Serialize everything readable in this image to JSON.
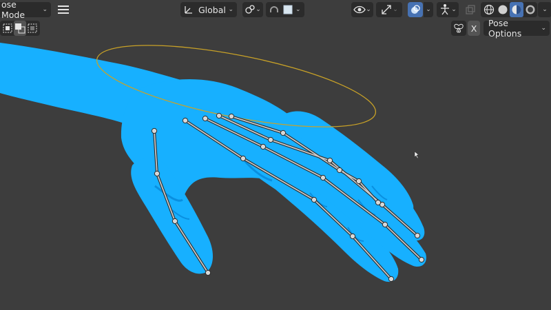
{
  "header": {
    "mode_label": "ose Mode",
    "transform_orientation": "Global"
  },
  "subheader": {
    "pose_options_label": "Pose Options",
    "mirror_x_label": "X"
  },
  "colors": {
    "mesh": "#17b0ff",
    "mesh_shadow": "#0a8fe0",
    "bone": "#c8c8c8",
    "gizmo": "#c9a227",
    "active": "#4772b3",
    "background": "#3d3d3d"
  }
}
